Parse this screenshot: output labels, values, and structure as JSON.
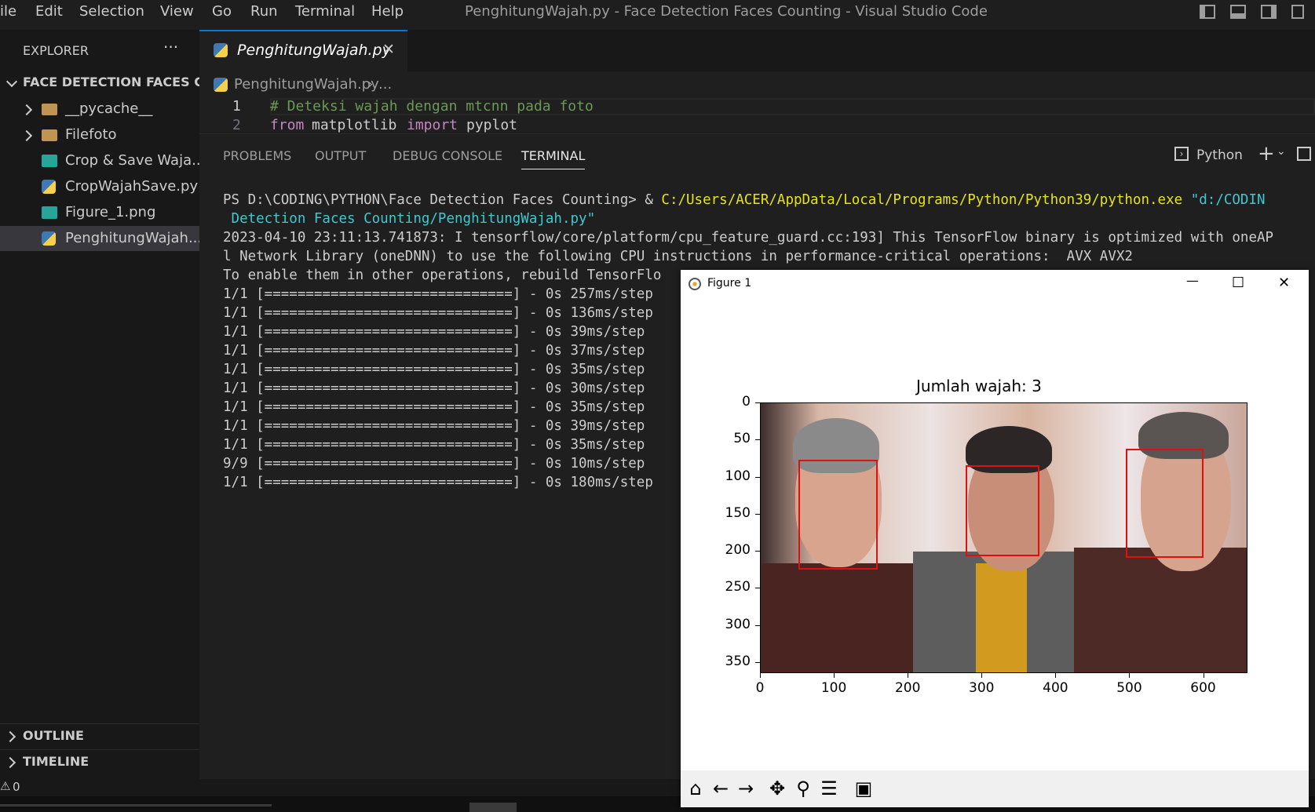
{
  "titlebar": {
    "menu": [
      "ile",
      "Edit",
      "Selection",
      "View",
      "Go",
      "Run",
      "Terminal",
      "Help"
    ],
    "window_title": "PenghitungWajah.py - Face Detection Faces Counting - Visual Studio Code"
  },
  "sidebar": {
    "header": "EXPLORER",
    "more": "···",
    "folder_name": "FACE DETECTION FACES C...",
    "items": [
      {
        "label": "__pycache__",
        "type": "folder"
      },
      {
        "label": "Filefoto",
        "type": "folder"
      },
      {
        "label": "Crop & Save Waja...",
        "type": "image"
      },
      {
        "label": "CropWajahSave.py",
        "type": "python"
      },
      {
        "label": "Figure_1.png",
        "type": "image"
      },
      {
        "label": "PenghitungWajah....",
        "type": "python"
      }
    ],
    "outline": "OUTLINE",
    "timeline": "TIMELINE"
  },
  "editor": {
    "tab_label": "PenghitungWajah.py",
    "tab_close": "✕",
    "breadcrumb_file": "PenghitungWajah.py",
    "breadcrumb_more": "...",
    "line1_num": "1",
    "line1_code": "# Deteksi wajah dengan mtcnn pada foto",
    "line2_num": "2",
    "line2_kw1": "from",
    "line2_mod": "matplotlib",
    "line2_kw2": "import",
    "line2_name": "pyplot"
  },
  "panel": {
    "tabs": [
      "PROBLEMS",
      "OUTPUT",
      "DEBUG CONSOLE",
      "TERMINAL"
    ],
    "active_tab": "TERMINAL",
    "shell_label": "Python",
    "terminal": {
      "prompt": "PS D:\\CODING\\PYTHON\\Face Detection Faces Counting> & ",
      "exe_path": "C:/Users/ACER/AppData/Local/Programs/Python/Python39/python.exe",
      "arg1": " \"d:/CODIN",
      "arg2": " Detection Faces Counting/PenghitungWajah.py\"",
      "tf_line1": "2023-04-10 23:11:13.741873: I tensorflow/core/platform/cpu_feature_guard.cc:193] This TensorFlow binary is optimized with oneAP",
      "tf_line2": "l Network Library (oneDNN) to use the following CPU instructions in performance-critical operations:  AVX AVX2",
      "tf_line3": "To enable them in other operations, rebuild TensorFlo",
      "steps": [
        "1/1 [==============================] - 0s 257ms/step",
        "1/1 [==============================] - 0s 136ms/step",
        "1/1 [==============================] - 0s 39ms/step",
        "1/1 [==============================] - 0s 37ms/step",
        "1/1 [==============================] - 0s 35ms/step",
        "1/1 [==============================] - 0s 30ms/step",
        "1/1 [==============================] - 0s 35ms/step",
        "1/1 [==============================] - 0s 39ms/step",
        "1/1 [==============================] - 0s 35ms/step",
        "9/9 [==============================] - 0s 10ms/step",
        "1/1 [==============================] - 0s 180ms/step"
      ]
    }
  },
  "statusbar": {
    "warnings": "0"
  },
  "figure_window": {
    "title": "Figure 1",
    "minimize": "—",
    "maximize": "☐",
    "close": "✕",
    "toolbar_icons": [
      "home-icon",
      "back-icon",
      "forward-icon",
      "pan-icon",
      "zoom-icon",
      "configure-icon",
      "save-icon"
    ]
  },
  "chart_data": {
    "type": "image",
    "title": "Jumlah wajah: 3",
    "x_ticks": [
      0,
      100,
      200,
      300,
      400,
      500,
      600
    ],
    "y_ticks": [
      0,
      50,
      100,
      150,
      200,
      250,
      300,
      350
    ],
    "xlim": [
      0,
      660
    ],
    "ylim": [
      365,
      0
    ],
    "face_boxes": [
      {
        "x": 52,
        "y": 77,
        "w": 107,
        "h": 148
      },
      {
        "x": 278,
        "y": 85,
        "w": 100,
        "h": 122
      },
      {
        "x": 495,
        "y": 62,
        "w": 105,
        "h": 148
      }
    ],
    "box_color": "#e01010"
  }
}
